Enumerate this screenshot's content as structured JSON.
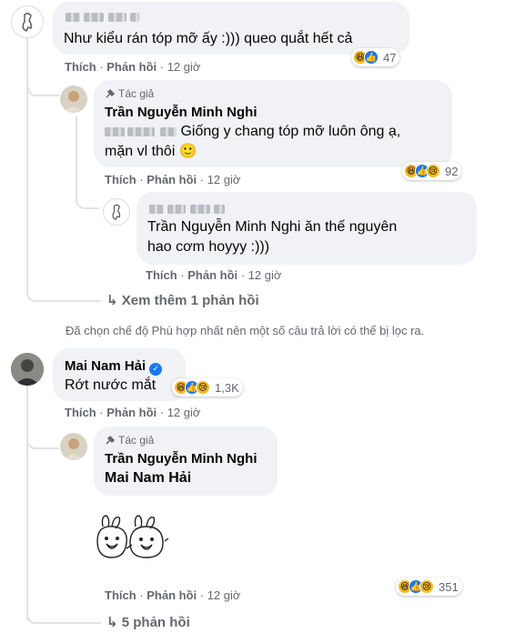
{
  "actions": {
    "like": "Thích",
    "reply": "Phản hồi",
    "time": "12 giờ"
  },
  "comment1": {
    "text": "Như kiểu rán tóp mỡ ấy :))) queo quắt hết cả",
    "reaction_count": "47"
  },
  "reply1": {
    "author_badge": "Tác giả",
    "name": "Trần Nguyễn Minh Nghi",
    "text_line1": "Giống y chang tóp mỡ luôn ông ạ,",
    "text_line2": "mặn vl thôi",
    "emoji": "🙂",
    "reaction_count": "92"
  },
  "reply2": {
    "text_line1": "Trần Nguyễn Minh Nghi ăn thế nguyên",
    "text_line2": "hao cơm hoyyy :)))"
  },
  "view_more_1": "Xem thêm 1 phản hồi",
  "notice": "Đã chọn chế độ Phù hợp nhất nên một số câu trả lời có thể bị lọc ra.",
  "comment2": {
    "name": "Mai Nam Hải",
    "verified_icon": "verified-check",
    "text": "Rớt nước mắt",
    "reaction_count": "1,3K"
  },
  "reply3": {
    "author_badge": "Tác giả",
    "name": "Trần Nguyễn Minh Nghi",
    "mention": "Mai Nam Hải",
    "sticker": "bunny-sticker",
    "reaction_count": "351"
  },
  "view_more_2": "5 phản hồi",
  "colors": {
    "like_blue": "#1877f2",
    "bubble": "#f0f2f5",
    "meta_gray": "#65676b"
  }
}
